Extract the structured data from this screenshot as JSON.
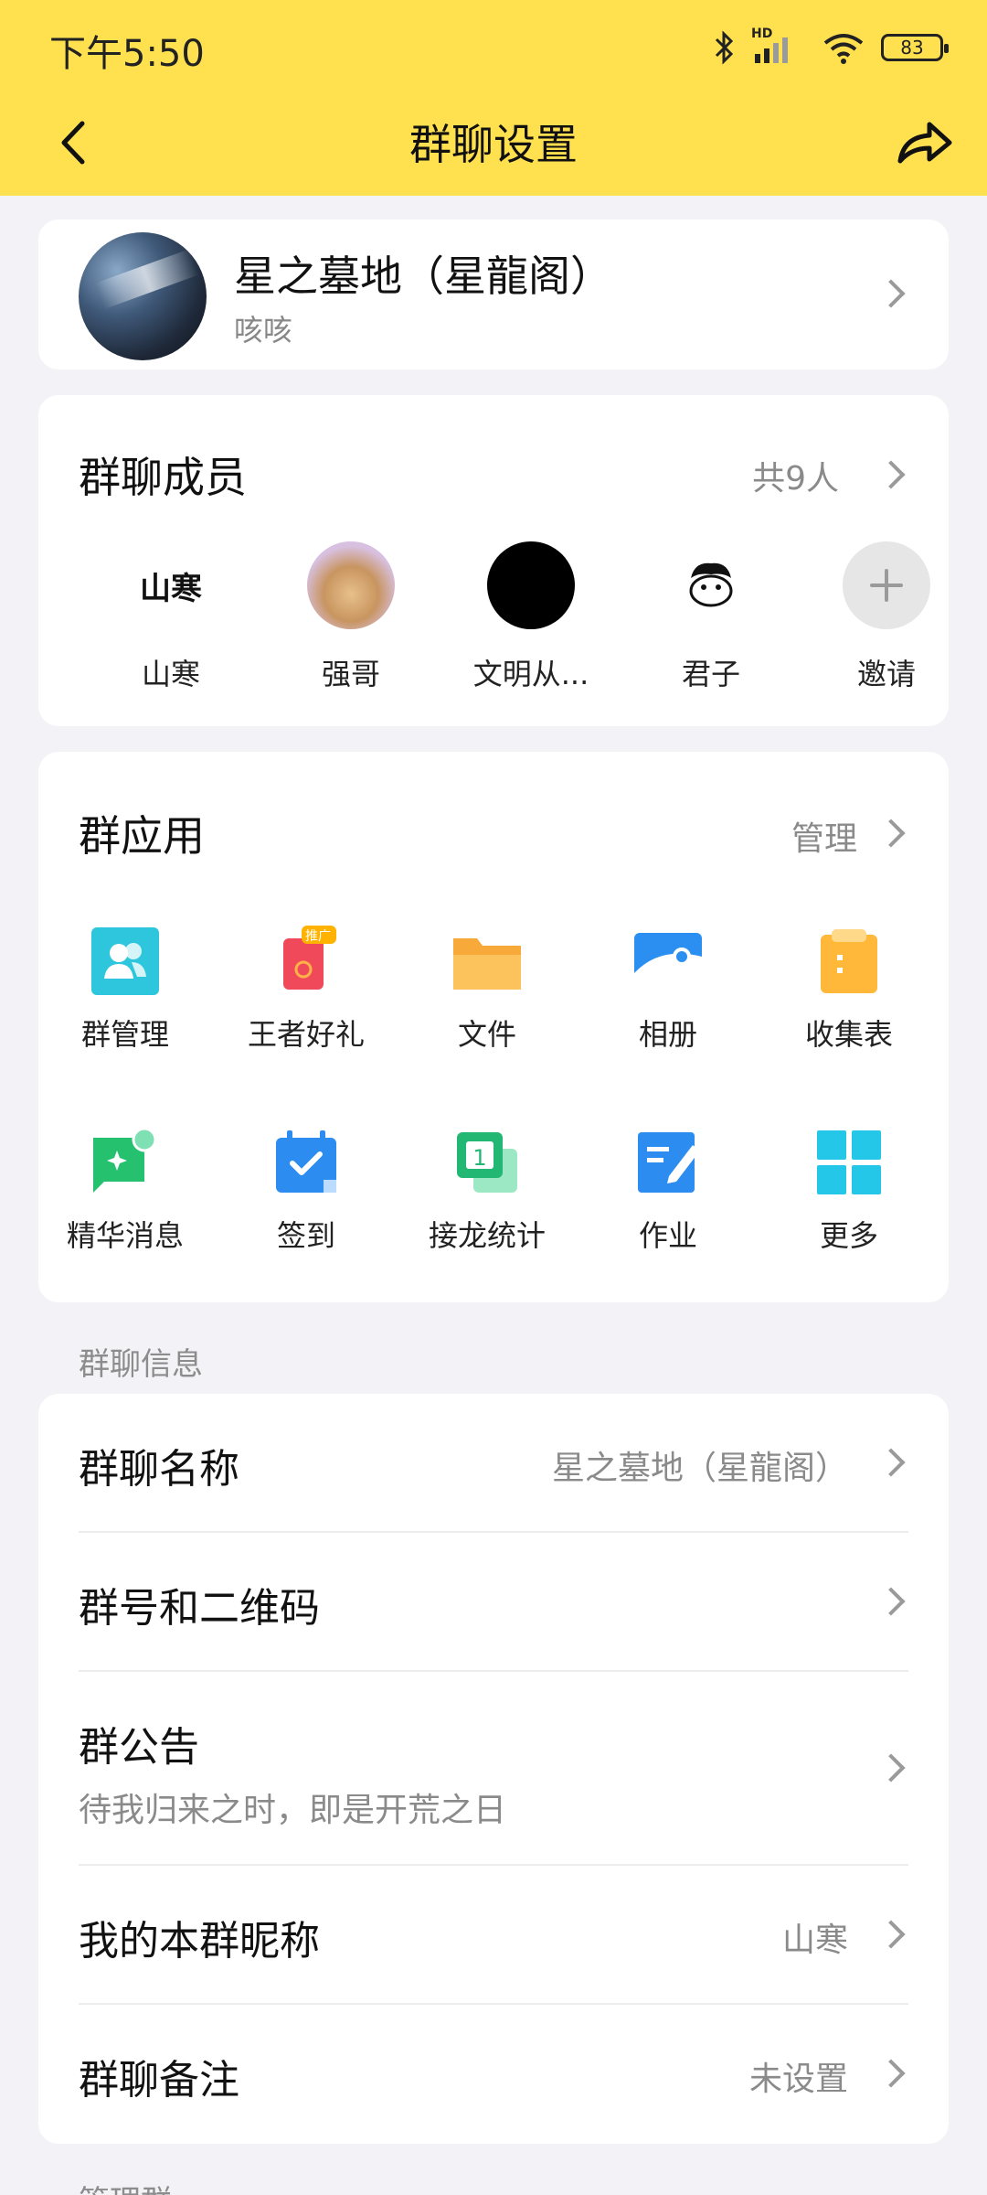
{
  "status_bar": {
    "time": "下午5:50",
    "battery": "83",
    "network_badge": "HD"
  },
  "nav": {
    "title": "群聊设置",
    "back_icon": "back-chevron-icon",
    "share_icon": "share-arrow-icon"
  },
  "group": {
    "name": "星之墓地（星龍阁）",
    "subtitle": "咳咳"
  },
  "members": {
    "title": "群聊成员",
    "count_text": "共9人",
    "list": [
      {
        "name": "山寒"
      },
      {
        "name": "强哥"
      },
      {
        "name": "文明从..."
      },
      {
        "name": "君子"
      },
      {
        "name": "邀请"
      }
    ]
  },
  "apps": {
    "title": "群应用",
    "manage": "管理",
    "items": [
      {
        "label": "群管理",
        "icon": "group-manage-icon"
      },
      {
        "label": "王者好礼",
        "icon": "gift-icon",
        "badge": "推广"
      },
      {
        "label": "文件",
        "icon": "folder-icon"
      },
      {
        "label": "相册",
        "icon": "album-icon"
      },
      {
        "label": "收集表",
        "icon": "clipboard-icon"
      },
      {
        "label": "精华消息",
        "icon": "highlight-message-icon"
      },
      {
        "label": "签到",
        "icon": "checkin-calendar-icon"
      },
      {
        "label": "接龙统计",
        "icon": "relay-stats-icon"
      },
      {
        "label": "作业",
        "icon": "homework-icon"
      },
      {
        "label": "更多",
        "icon": "more-grid-icon"
      }
    ]
  },
  "info": {
    "section_label": "群聊信息",
    "rows": [
      {
        "title": "群聊名称",
        "value": "星之墓地（星龍阁）"
      },
      {
        "title": "群号和二维码",
        "value": ""
      },
      {
        "title": "群公告",
        "subtitle": "待我归来之时，即是开荒之日"
      },
      {
        "title": "我的本群昵称",
        "value": "山寒"
      },
      {
        "title": "群聊备注",
        "value": "未设置"
      }
    ]
  },
  "bottom_section_label": "管理群",
  "colors": {
    "header": "#ffe04f",
    "background": "#f2f2f7"
  }
}
